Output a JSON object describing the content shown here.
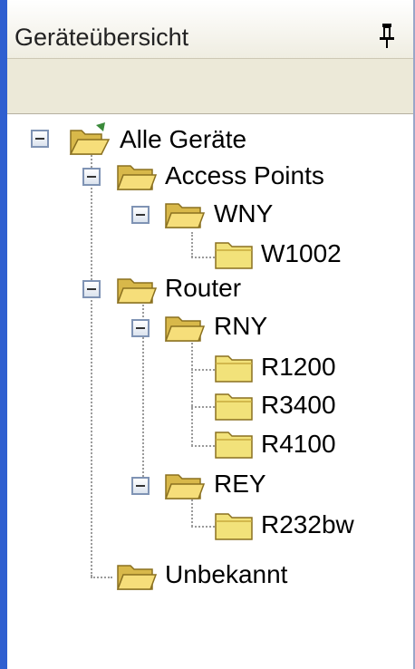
{
  "panel": {
    "title": "Geräteübersicht"
  },
  "tree": {
    "root": "Alle Geräte",
    "access_points": "Access Points",
    "wny": "WNY",
    "w1002": "W1002",
    "router": "Router",
    "rny": "RNY",
    "r1200": "R1200",
    "r3400": "R3400",
    "r4100": "R4100",
    "rey": "REY",
    "r232bw": "R232bw",
    "unbekannt": "Unbekannt"
  },
  "icons": {
    "pin": "pin-icon",
    "open_folder": "folder-open-icon",
    "closed_folder": "folder-icon"
  },
  "colors": {
    "window_border": "#2f5fd0",
    "header_bg": "#ece9d8",
    "folder_yellow": "#f2e27a"
  }
}
